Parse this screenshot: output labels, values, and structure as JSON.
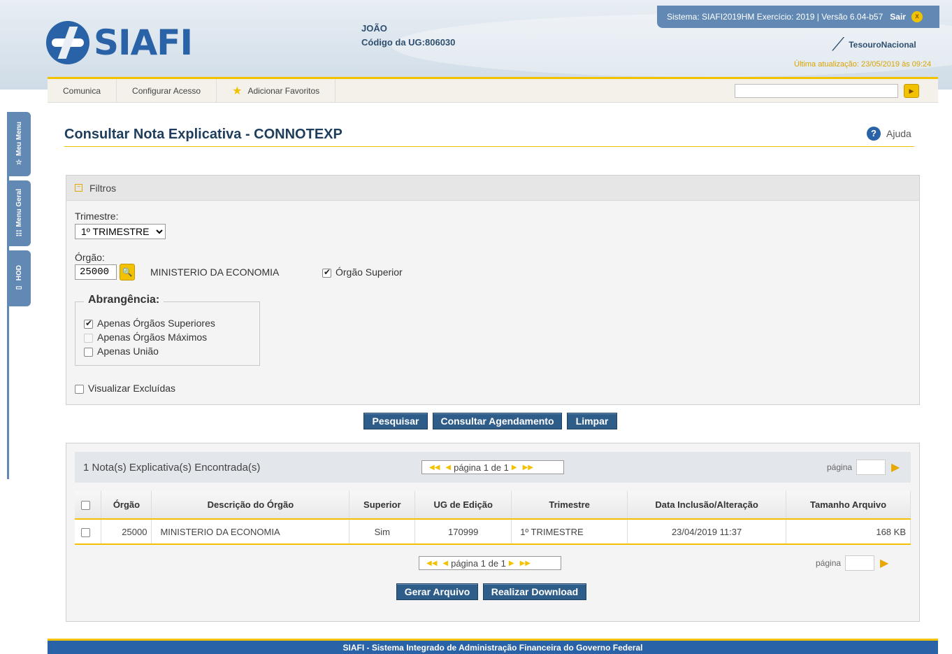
{
  "header": {
    "logo_text": "SIAFI",
    "user_name": "JOÃO",
    "ug_label": "Código da UG:",
    "ug_code": "806030",
    "system_info": "Sistema: SIAFI2019HM Exercício: 2019 | Versão 6.04-b57",
    "sair_label": "Sair",
    "brand": "TesouroNacional",
    "last_update": "Última atualização: 23/05/2019 às 09:24"
  },
  "toolbar": {
    "comunica": "Comunica",
    "configurar": "Configurar Acesso",
    "favoritos": "Adicionar Favoritos",
    "search_value": ""
  },
  "sidebar": {
    "tabs": [
      {
        "label": "Meu Menu",
        "icon": "star-icon"
      },
      {
        "label": "Menu Geral",
        "icon": "sitemap-icon"
      },
      {
        "label": "HOD",
        "icon": "monitor-icon"
      }
    ]
  },
  "page": {
    "title": "Consultar Nota Explicativa - CONNOTEXP",
    "help_label": "Ajuda"
  },
  "filters": {
    "section_title": "Filtros",
    "trimestre_label": "Trimestre:",
    "trimestre_value": "1º TRIMESTRE",
    "orgao_label": "Órgão:",
    "orgao_code": "25000",
    "orgao_name": "MINISTERIO DA ECONOMIA",
    "orgao_superior_label": "Órgão Superior",
    "orgao_superior_checked": true,
    "abrangencia_title": "Abrangência:",
    "abrangencia_options": [
      {
        "label": "Apenas Órgãos Superiores",
        "checked": true,
        "disabled": false
      },
      {
        "label": "Apenas Órgãos Máximos",
        "checked": false,
        "disabled": true
      },
      {
        "label": "Apenas União",
        "checked": false,
        "disabled": false
      }
    ],
    "visualizar_excluidas_label": "Visualizar Excluídas",
    "visualizar_excluidas_checked": false
  },
  "actions": {
    "pesquisar": "Pesquisar",
    "consultar_agendamento": "Consultar Agendamento",
    "limpar": "Limpar"
  },
  "results": {
    "count_text": "1 Nota(s) Explicativa(s) Encontrada(s)",
    "pager_text": "página 1 de 1",
    "page_label": "página",
    "columns": [
      "Órgão",
      "Descrição do Órgão",
      "Superior",
      "UG de Edição",
      "Trimestre",
      "Data Inclusão/Alteração",
      "Tamanho Arquivo"
    ],
    "rows": [
      {
        "orgao": "25000",
        "descricao": "MINISTERIO DA ECONOMIA",
        "superior": "Sim",
        "ug_edicao": "170999",
        "trimestre": "1º TRIMESTRE",
        "data": "23/04/2019 11:37",
        "tamanho": "168 KB"
      }
    ],
    "gerar_arquivo": "Gerar Arquivo",
    "realizar_download": "Realizar Download"
  },
  "footer": {
    "text": "SIAFI - Sistema Integrado de Administração Financeira do Governo Federal"
  },
  "colors": {
    "brand_blue": "#2a62a7",
    "accent_yellow": "#f2c200",
    "button_blue": "#2f5d8a"
  }
}
